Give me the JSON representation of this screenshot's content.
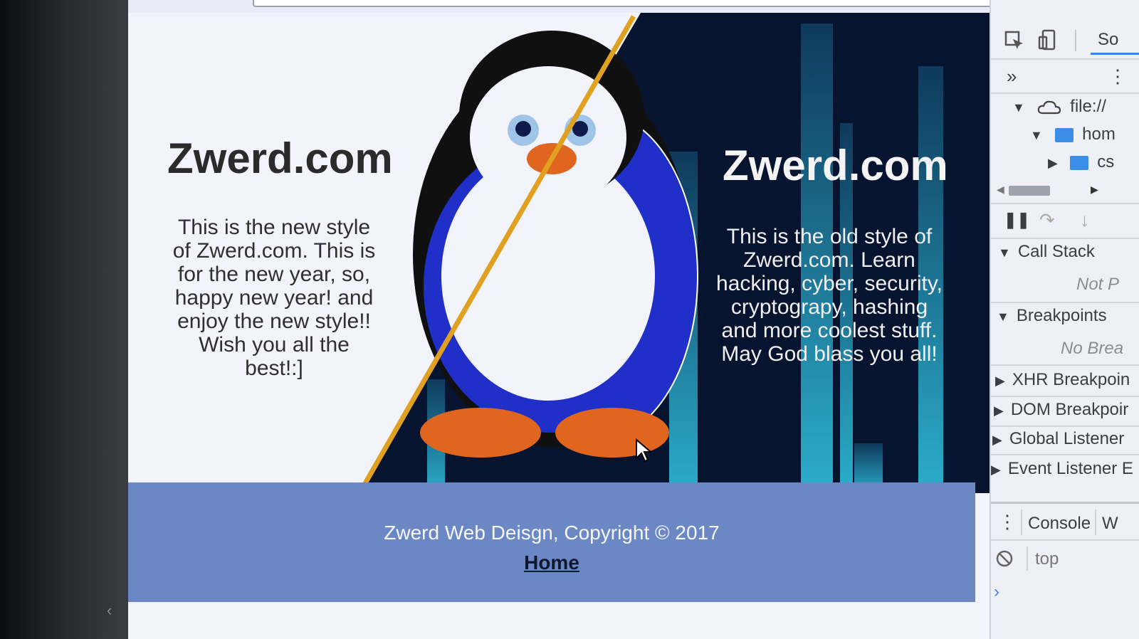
{
  "page": {
    "new_style": {
      "title": "Zwerd.com",
      "description": "This is the new style of Zwerd.com. This is for the new year, so, happy new year! and enjoy the new style!! Wish you all the best!:]"
    },
    "old_style": {
      "title": "Zwerd.com",
      "description": "This is the old style of Zwerd.com. Learn hacking, cyber, security, cryptograpy, hashing and more coolest stuff. May God blass you all!"
    },
    "footer": {
      "copyright": "Zwerd Web Deisgn, Copyright © 2017",
      "home_link": "Home"
    }
  },
  "devtools": {
    "sources_tab": "So",
    "tree": {
      "root": "file://",
      "folder1": "hom",
      "folder2": "cs"
    },
    "call_stack": {
      "label": "Call Stack",
      "status": "Not P"
    },
    "breakpoints": {
      "label": "Breakpoints",
      "status": "No Brea"
    },
    "sections": [
      "XHR Breakpoin",
      "DOM Breakpoir",
      "Global Listener",
      "Event Listener E"
    ],
    "drawer": {
      "console_tab": "Console",
      "next_tab": "W",
      "context": "top"
    }
  },
  "colors": {
    "footer": "#6b87c4",
    "dark_bg": "#061430",
    "divider": "#e0a020",
    "penguin_blue": "#1f2fc8",
    "beak_feet": "#e0661f"
  },
  "icons": [
    "inspect-icon",
    "device-icon",
    "more-tabs-icon",
    "menu-icon",
    "cloud-icon",
    "folder-icon",
    "pause-icon",
    "step-over-icon",
    "step-into-icon",
    "block-icon",
    "prompt-icon",
    "chevron-left-icon",
    "cursor-icon"
  ]
}
